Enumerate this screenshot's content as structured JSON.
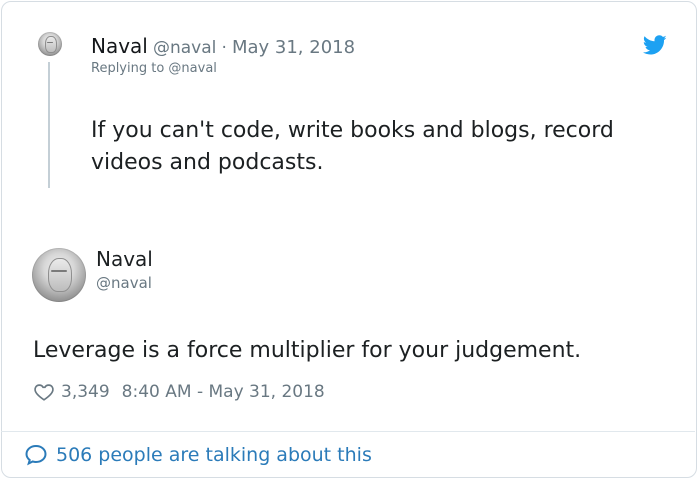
{
  "reply": {
    "name": "Naval",
    "handle": "@naval",
    "separator": "·",
    "date": "May 31, 2018",
    "replying_to": "Replying to @naval",
    "text": "If you can't code, write books and blogs, record videos and podcasts."
  },
  "tweet": {
    "name": "Naval",
    "handle": "@naval",
    "text": "Leverage is a force multiplier for your judgement.",
    "likes": "3,349",
    "timestamp": "8:40 AM - May 31, 2018"
  },
  "footer": {
    "talking": "506 people are talking about this"
  },
  "icons": {
    "brand": "twitter-bird-icon",
    "like": "heart-icon",
    "comment": "comment-bubble-icon"
  },
  "colors": {
    "brand_blue": "#1da1f2",
    "link_blue": "#2b7bb9",
    "secondary_text": "#697882",
    "border": "#d6dde3"
  }
}
